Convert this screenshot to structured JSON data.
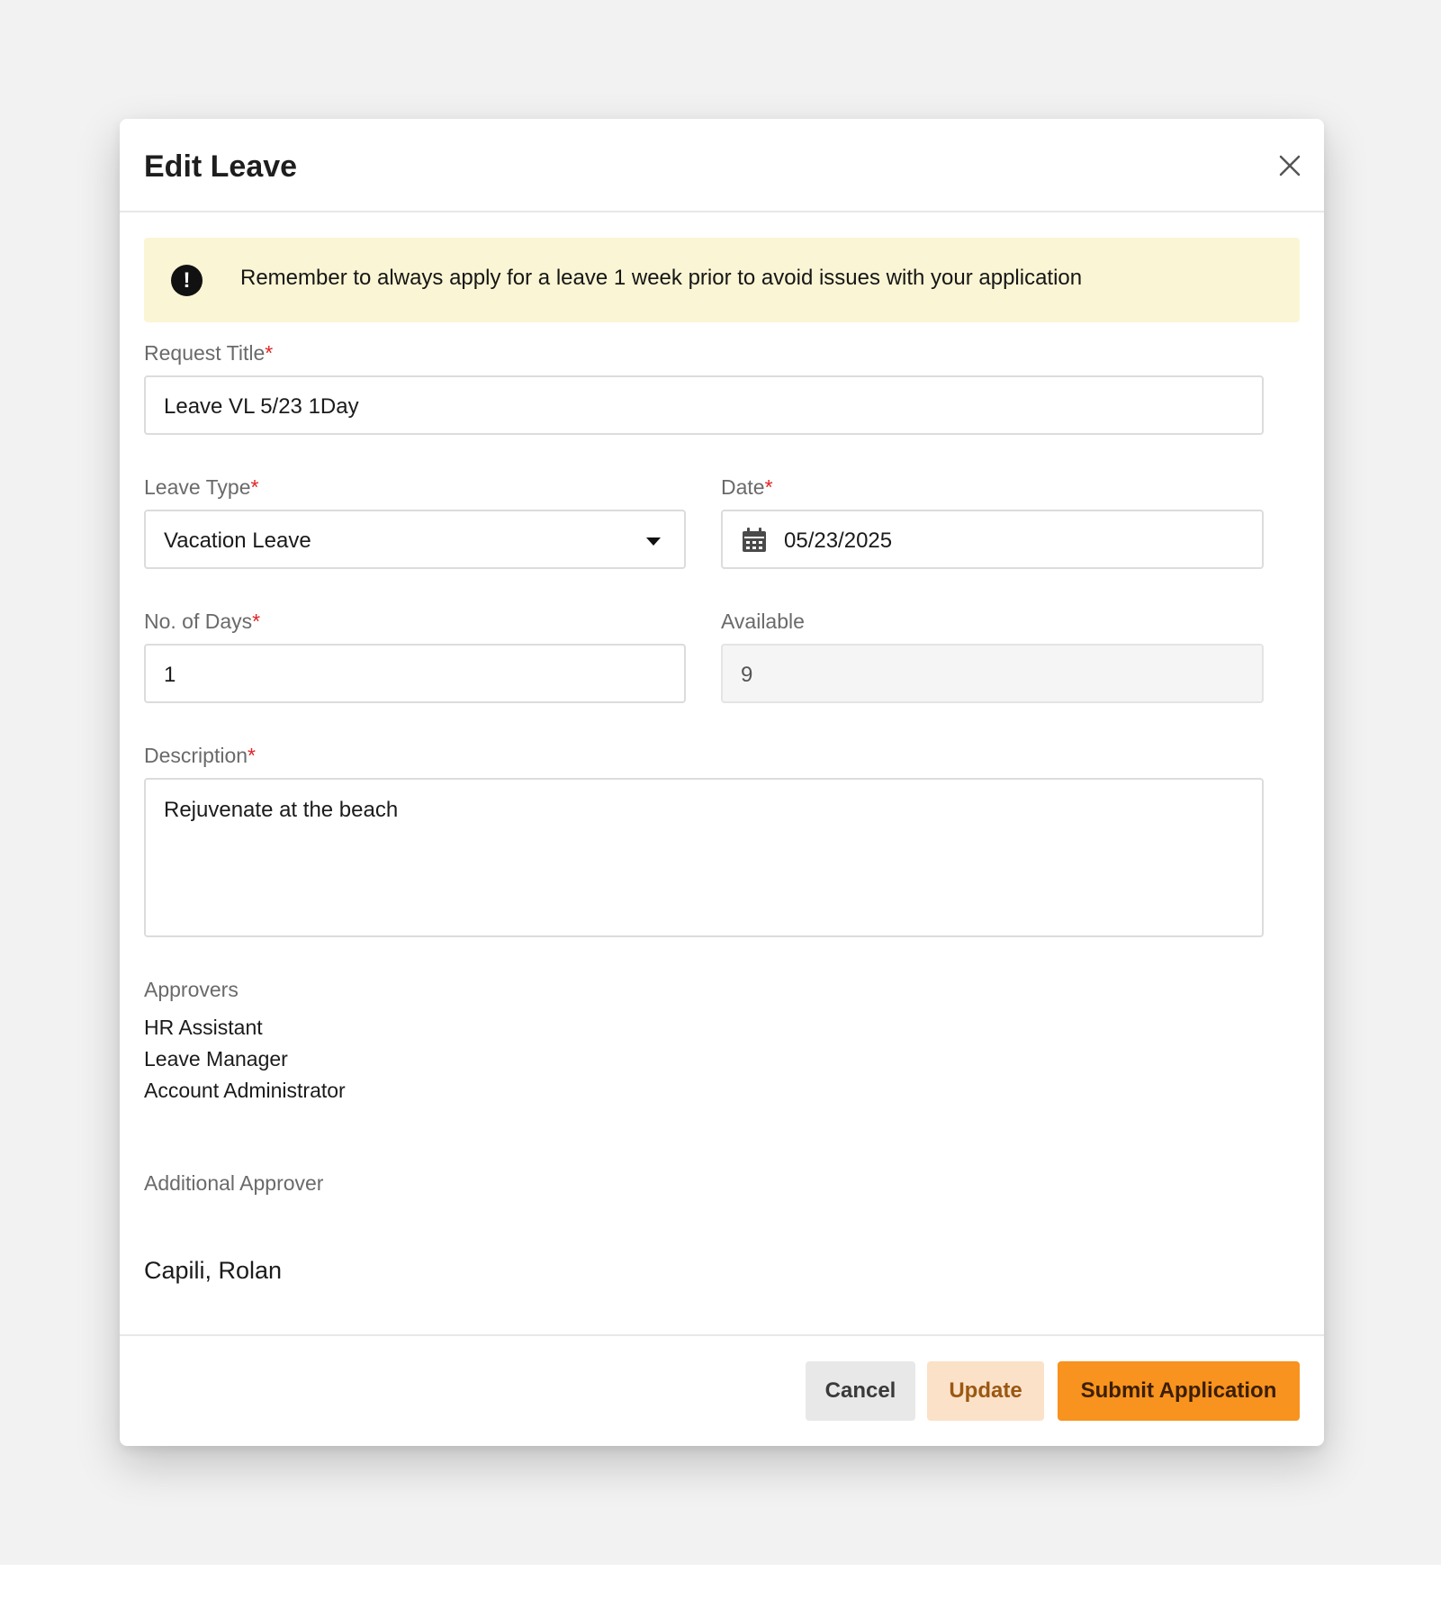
{
  "modal": {
    "title": "Edit Leave",
    "close_icon": "close-icon"
  },
  "alert": {
    "icon": "exclamation-circle-icon",
    "message": "Remember to always apply for a leave 1 week prior to avoid issues with your application",
    "background": "#faf5d4"
  },
  "form": {
    "request_title": {
      "label": "Request Title",
      "required": "*",
      "value": "Leave VL 5/23 1Day"
    },
    "leave_type": {
      "label": "Leave Type",
      "required": "*",
      "value": "Vacation Leave",
      "icon": "chevron-down-icon"
    },
    "date": {
      "label": "Date",
      "required": "*",
      "value": "05/23/2025",
      "icon": "calendar-icon"
    },
    "no_of_days": {
      "label": "No. of Days",
      "required": "*",
      "value": "1"
    },
    "available": {
      "label": "Available",
      "value": "9"
    },
    "description": {
      "label": "Description",
      "required": "*",
      "value": "Rejuvenate at the beach"
    }
  },
  "approvers": {
    "label": "Approvers",
    "items": [
      "HR Assistant",
      "Leave Manager",
      "Account Administrator"
    ]
  },
  "additional_approver": {
    "label": "Additional Approver",
    "value": "Capili, Rolan"
  },
  "footer": {
    "cancel_label": "Cancel",
    "update_label": "Update",
    "submit_label": "Submit Application"
  },
  "colors": {
    "accent": "#f7931e",
    "required": "#e02424",
    "update_bg": "#fbe1c8"
  }
}
